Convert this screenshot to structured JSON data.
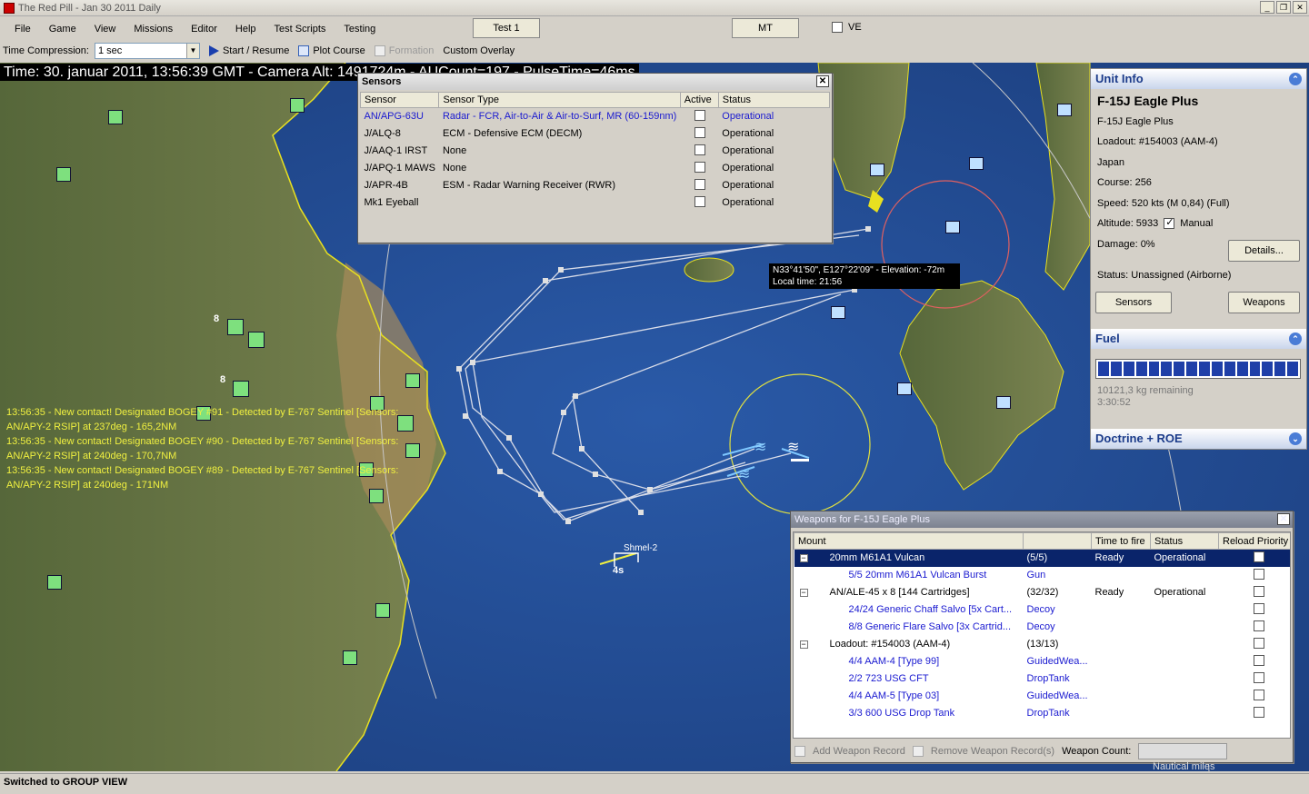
{
  "window": {
    "title": "The Red Pill - Jan 30 2011 Daily"
  },
  "menubar": {
    "items": [
      "File",
      "Game",
      "View",
      "Missions",
      "Editor",
      "Help",
      "Test Scripts",
      "Testing"
    ],
    "test1_label": "Test 1",
    "mt_label": "MT",
    "ve_label": "VE"
  },
  "toolbar": {
    "time_compression_label": "Time Compression:",
    "time_compression_value": "1 sec",
    "start_resume": "Start / Resume",
    "plot_course": "Plot Course",
    "formation": "Formation",
    "custom_overlay": "Custom Overlay"
  },
  "map": {
    "time_header": "Time: 30. januar 2011, 13:56:39 GMT - Camera Alt: 1491724m - AUCount=197 - PulseTime=46ms",
    "messages": [
      "13:56:35 - New contact! Designated BOGEY #91 - Detected by E-767 Sentinel [Sensors: AN/APY-2 RSIP] at 237deg - 165,2NM",
      "13:56:35 - New contact! Designated BOGEY #90 - Detected by E-767 Sentinel [Sensors: AN/APY-2 RSIP] at 240deg - 170,7NM",
      "13:56:35 - New contact! Designated BOGEY #89 - Detected by E-767 Sentinel [Sensors: AN/APY-2 RSIP] at 240deg - 171NM"
    ],
    "coord_tooltip_line1": "N33°41'50\", E127°22'09\" - Elevation: -72m",
    "coord_tooltip_line2": "Local time: 21:56",
    "unit_label_shmel": "Shmel-2",
    "unit_label_4s": "4s",
    "group_count_1": "8",
    "group_count_2": "8",
    "scale_label": "Nautical miles",
    "colors": {
      "sea": "#24498c",
      "land": "#6b7a4a",
      "coast": "#e8e020",
      "route": "#d8dce8",
      "range_ring_yellow": "#e0e040",
      "range_ring_red": "#e06060"
    }
  },
  "sensors_window": {
    "title": "Sensors",
    "columns": [
      "Sensor",
      "Sensor Type",
      "Active",
      "Status"
    ],
    "rows": [
      {
        "sensor": "AN/APG-63U",
        "type": "Radar - FCR, Air-to-Air & Air-to-Surf, MR (60-159nm)",
        "active": false,
        "status": "Operational",
        "highlight": true
      },
      {
        "sensor": "J/ALQ-8",
        "type": "ECM - Defensive ECM (DECM)",
        "active": false,
        "status": "Operational",
        "highlight": false
      },
      {
        "sensor": "J/AAQ-1 IRST",
        "type": "None",
        "active": false,
        "status": "Operational",
        "highlight": false
      },
      {
        "sensor": "J/APQ-1 MAWS",
        "type": "None",
        "active": false,
        "status": "Operational",
        "highlight": false
      },
      {
        "sensor": "J/APR-4B",
        "type": "ESM - Radar Warning Receiver (RWR)",
        "active": false,
        "status": "Operational",
        "highlight": false
      },
      {
        "sensor": "Mk1 Eyeball",
        "type": "",
        "active": false,
        "status": "Operational",
        "highlight": false
      }
    ]
  },
  "weapons_window": {
    "title": "Weapons for F-15J Eagle Plus",
    "columns": [
      "Mount",
      "",
      "Time to fire",
      "Status",
      "Reload Priority"
    ],
    "rows": [
      {
        "mount": "20mm M61A1 Vulcan",
        "qty": "(5/5)",
        "time": "Ready",
        "status": "Operational",
        "level": 0,
        "expander": "−",
        "selected": true
      },
      {
        "mount": "5/5  20mm M61A1 Vulcan Burst",
        "qty": "Gun",
        "time": "",
        "status": "",
        "level": 1,
        "expander": "",
        "selected": false
      },
      {
        "mount": "AN/ALE-45 x 8 [144 Cartridges]",
        "qty": "(32/32)",
        "time": "Ready",
        "status": "Operational",
        "level": 0,
        "expander": "−",
        "selected": false
      },
      {
        "mount": "24/24  Generic Chaff Salvo [5x Cart...",
        "qty": "Decoy",
        "time": "",
        "status": "",
        "level": 1,
        "expander": "",
        "selected": false
      },
      {
        "mount": "8/8  Generic Flare Salvo [3x Cartrid...",
        "qty": "Decoy",
        "time": "",
        "status": "",
        "level": 1,
        "expander": "",
        "selected": false
      },
      {
        "mount": "Loadout: #154003 (AAM-4)",
        "qty": "(13/13)",
        "time": "",
        "status": "",
        "level": 0,
        "expander": "−",
        "selected": false
      },
      {
        "mount": "4/4  AAM-4 [Type 99]",
        "qty": "GuidedWea...",
        "time": "",
        "status": "",
        "level": 1,
        "expander": "",
        "selected": false
      },
      {
        "mount": "2/2  723 USG CFT",
        "qty": "DropTank",
        "time": "",
        "status": "",
        "level": 1,
        "expander": "",
        "selected": false
      },
      {
        "mount": "4/4  AAM-5 [Type 03]",
        "qty": "GuidedWea...",
        "time": "",
        "status": "",
        "level": 1,
        "expander": "",
        "selected": false
      },
      {
        "mount": "3/3  600 USG Drop Tank",
        "qty": "DropTank",
        "time": "",
        "status": "",
        "level": 1,
        "expander": "",
        "selected": false
      }
    ],
    "add_record": "Add Weapon Record",
    "remove_record": "Remove Weapon Record(s)",
    "weapon_count_label": "Weapon Count:",
    "weapon_count_value": ""
  },
  "unit_info": {
    "header": "Unit Info",
    "name": "F-15J Eagle Plus",
    "class": "F-15J Eagle Plus",
    "loadout": "Loadout: #154003 (AAM-4)",
    "side": "Japan",
    "course": "Course: 256",
    "speed": "Speed: 520 kts (M 0,84) (Full)",
    "altitude": "Altitude: 5933",
    "manual_label": "Manual",
    "manual_checked": true,
    "damage": "Damage: 0%",
    "details_button": "Details...",
    "status": "Status: Unassigned (Airborne)",
    "sensors_button": "Sensors",
    "weapons_button": "Weapons",
    "fuel_header": "Fuel",
    "fuel_remaining": "10121,3 kg remaining",
    "fuel_time": "3:30:52",
    "fuel_fraction": 1.0,
    "doctrine_header": "Doctrine + ROE"
  },
  "statusbar": {
    "text": "Switched to GROUP VIEW"
  }
}
